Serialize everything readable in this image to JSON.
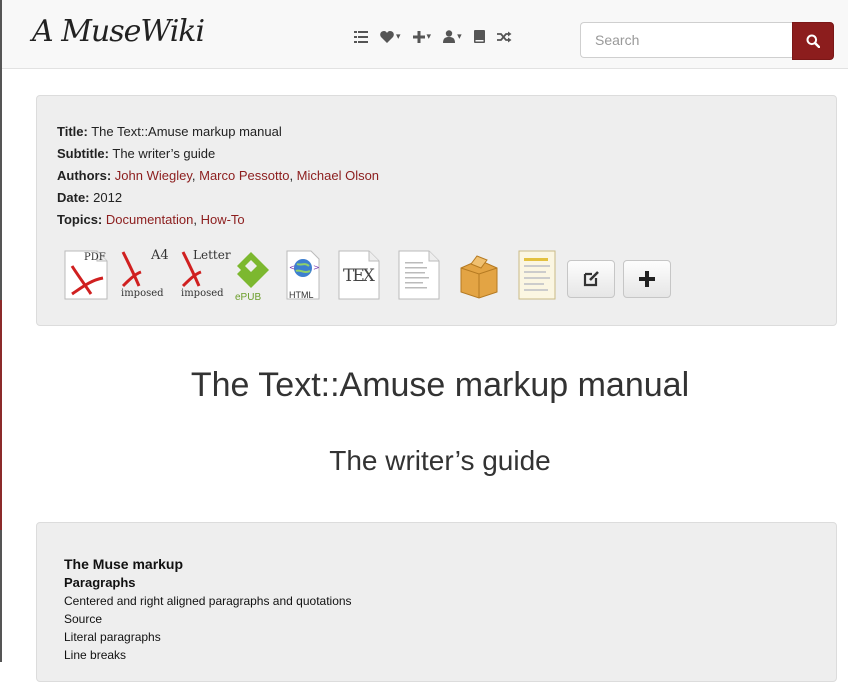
{
  "brand": "A MuseWiki",
  "nav": {
    "icons": [
      "list-icon",
      "heart-icon",
      "plus-icon",
      "user-icon",
      "book-icon",
      "random-icon"
    ]
  },
  "search": {
    "placeholder": "Search"
  },
  "meta": {
    "title_label": "Title:",
    "title": "The Text::Amuse markup manual",
    "subtitle_label": "Subtitle:",
    "subtitle": "The writer’s guide",
    "authors_label": "Authors:",
    "authors": [
      "John Wiegley",
      "Marco Pessotto",
      "Michael Olson"
    ],
    "date_label": "Date:",
    "date": "2012",
    "topics_label": "Topics:",
    "topics": [
      "Documentation",
      "How-To"
    ],
    "separator": ", "
  },
  "formats": {
    "pdf": "PDF",
    "a4": "A4",
    "a4_sub": "imposed",
    "letter": "Letter",
    "letter_sub": "imposed",
    "epub": "ePUB",
    "html": "HTML",
    "tex": "TEX"
  },
  "colors": {
    "accent": "#8c1d1d",
    "well": "#eeeeee"
  },
  "page": {
    "title": "The Text::Amuse markup manual",
    "subtitle": "The writer’s guide"
  },
  "toc": {
    "heading": "The Muse markup",
    "section": "Paragraphs",
    "items": [
      "Centered and right aligned paragraphs and quotations",
      "Source",
      "Literal paragraphs",
      "Line breaks"
    ]
  }
}
